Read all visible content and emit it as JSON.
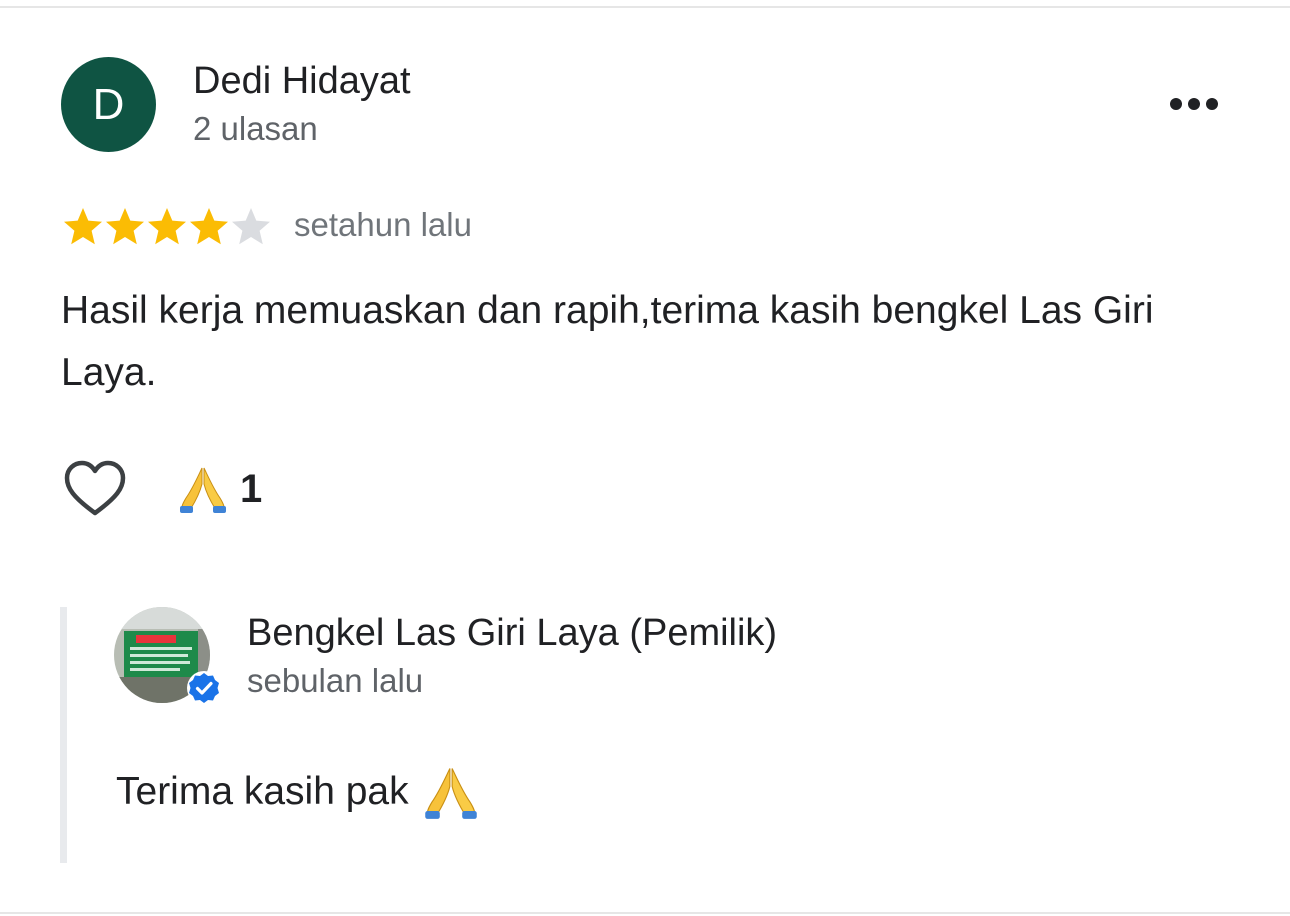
{
  "review": {
    "reviewer_initial": "D",
    "reviewer_name": "Dedi Hidayat",
    "review_count": "2 ulasan",
    "rating": 4,
    "rating_max": 5,
    "time": "setahun lalu",
    "text": "Hasil kerja memuaskan dan rapih,terima kasih bengkel Las Giri Laya.",
    "reaction_icon": "folded-hands-icon",
    "reaction_count": "1",
    "more_icon": "more-options-icon",
    "like_icon": "heart-outline-icon"
  },
  "reply": {
    "owner_name": "Bengkel Las Giri Laya (Pemilik)",
    "time": "sebulan lalu",
    "text": "Terima kasih pak",
    "emoji_icon": "folded-hands-icon",
    "badge_icon": "verified-badge-icon"
  },
  "colors": {
    "avatar_bg": "#0f5443",
    "star_filled": "#fbbc04",
    "star_empty": "#dadce0",
    "verified": "#1a73e8"
  }
}
